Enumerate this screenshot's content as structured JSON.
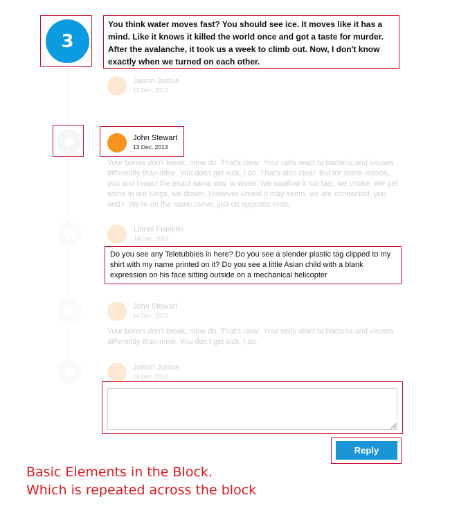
{
  "badge_number": "3",
  "intro_comment": "You think water moves fast? You should see ice. It moves like it has a mind. Like it knows it killed the world once and got a taste for murder. After the avalanche, it took us a week to climb out. Now, I don't know exactly when we turned on each other.",
  "comments": [
    {
      "author": "Jaison Justus",
      "date": "12 Dec, 2013"
    },
    {
      "author": "John Stewart",
      "date": "13 Dec, 2013",
      "text": "Your bones don't break, mine do. That's clear. Your cells react to bacteria and viruses differently than mine. You don't get sick, I do. That's also clear. But for some reason, you and I react the exact same way to water. We swallow it too fast, we choke. We get some in our lungs, we drown. However unreal it may seem, we are connected, you and I. We're on the same curve, just on opposite ends."
    },
    {
      "author": "Lionel Franklin",
      "date": "14 Dec, 2013",
      "text": "Do you see any Teletubbies in here? Do you see a slender plastic tag clipped to my shirt with my name printed on it? Do you see a little Asian child with a blank expression on his face sitting outside on a mechanical helicopter"
    },
    {
      "author": "John Stewart",
      "date": "14 Dec, 2013",
      "text": "Your bones don't break, mine do. That's clear. Your cells react to bacteria and viruses differently than mine. You don't get sick, I do."
    },
    {
      "author": "Jaison Justus",
      "date": "14 Dec, 2013"
    }
  ],
  "reply_input": {
    "value": "",
    "placeholder": ""
  },
  "reply_label": "Reply",
  "caption_lines": [
    "Basic Elements in the Block.",
    "Which is repeated across the block"
  ],
  "colors": {
    "accent": "#0a9be0",
    "button": "#1a95d6",
    "avatar_active": "#f7941d",
    "avatar_faint": "#fde9d3",
    "annotation": "#c8102e",
    "caption": "#e0191f"
  }
}
